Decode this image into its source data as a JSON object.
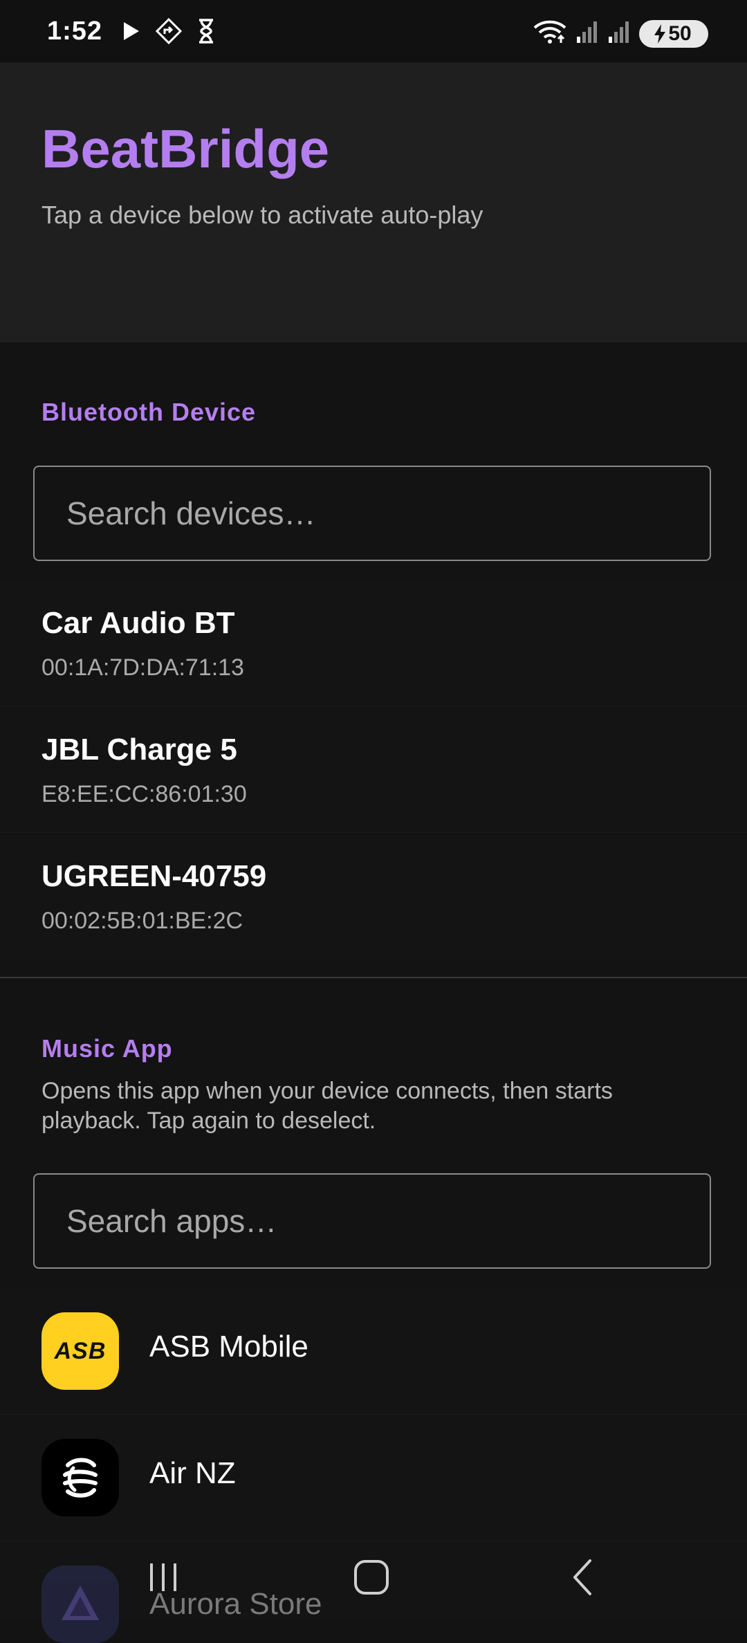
{
  "status_bar": {
    "time": "1:52",
    "battery_level": "50",
    "icons": [
      "play-icon",
      "navigation-diamond-icon",
      "hourglass-icon",
      "wifi-icon",
      "signal-icon",
      "signal-icon",
      "battery-charging-icon"
    ]
  },
  "header": {
    "title": "BeatBridge",
    "subtitle": "Tap a device below to activate auto-play"
  },
  "bluetooth": {
    "section_title": "Bluetooth Device",
    "search_placeholder": "Search devices…",
    "devices": [
      {
        "name": "Car Audio BT",
        "mac": "00:1A:7D:DA:71:13"
      },
      {
        "name": "JBL Charge 5",
        "mac": "E8:EE:CC:86:01:30"
      },
      {
        "name": "UGREEN-40759",
        "mac": "00:02:5B:01:BE:2C"
      }
    ]
  },
  "music_app": {
    "section_title": "Music App",
    "description": "Opens this app when your device connects, then starts playback. Tap again to deselect.",
    "search_placeholder": "Search apps…",
    "apps": [
      {
        "name": "ASB Mobile",
        "icon": "asb-logo-icon",
        "icon_text": "ASB"
      },
      {
        "name": "Air NZ",
        "icon": "air-nz-koru-icon"
      },
      {
        "name": "Aurora Store",
        "icon": "aurora-store-icon"
      }
    ]
  },
  "colors": {
    "accent": "#b57ef0",
    "background": "#131313",
    "header_bg": "#1f1f1f",
    "asb_yellow": "#ffd01f"
  }
}
